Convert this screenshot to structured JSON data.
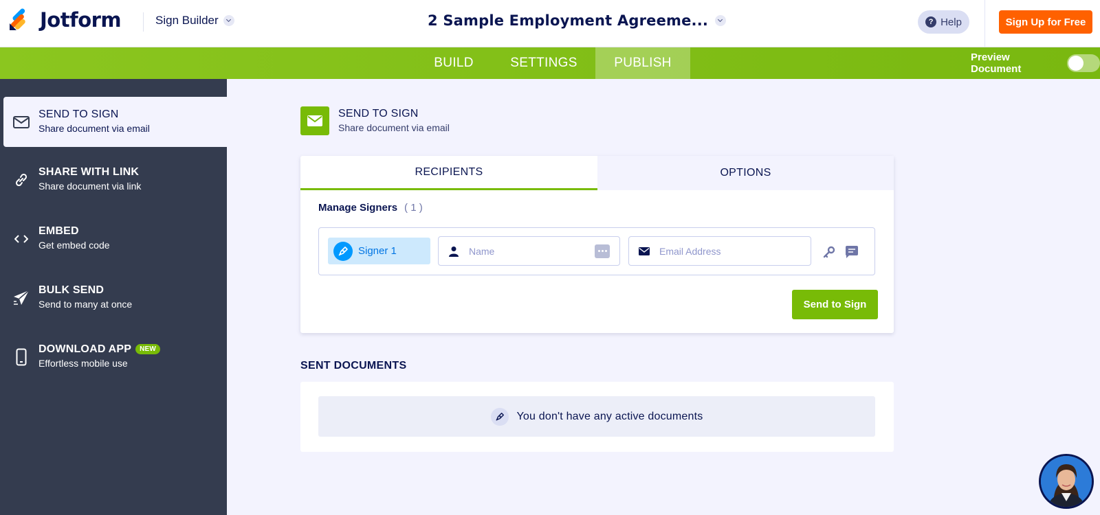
{
  "header": {
    "logo_text": "Jotform",
    "builder_label": "Sign Builder",
    "doc_title": "2 Sample Employment Agreeme...",
    "help_label": "Help",
    "signup_label": "Sign Up for Free"
  },
  "nav": {
    "tabs": [
      {
        "label": "BUILD"
      },
      {
        "label": "SETTINGS"
      },
      {
        "label": "PUBLISH",
        "active": true
      }
    ],
    "preview_label": "Preview Document",
    "preview_enabled": false
  },
  "sidebar": {
    "items": [
      {
        "title": "SEND TO SIGN",
        "subtitle": "Share document via email",
        "icon": "envelope-icon",
        "active": true
      },
      {
        "title": "SHARE WITH LINK",
        "subtitle": "Share document via link",
        "icon": "link-icon"
      },
      {
        "title": "EMBED",
        "subtitle": "Get embed code",
        "icon": "code-icon"
      },
      {
        "title": "BULK SEND",
        "subtitle": "Send to many at once",
        "icon": "paper-plane-icon"
      },
      {
        "title": "DOWNLOAD APP",
        "subtitle": "Effortless mobile use",
        "icon": "phone-icon",
        "badge": "NEW"
      }
    ]
  },
  "main": {
    "section_title": "SEND TO SIGN",
    "section_subtitle": "Share document via email",
    "tabs": [
      {
        "label": "RECIPIENTS",
        "active": true
      },
      {
        "label": "OPTIONS"
      }
    ],
    "manage_label": "Manage Signers",
    "manage_count": "( 1 )",
    "signer": {
      "label": "Signer 1",
      "name_placeholder": "Name",
      "email_placeholder": "Email Address"
    },
    "send_button": "Send to Sign",
    "sent_title": "SENT DOCUMENTS",
    "empty_message": "You don't have any active documents"
  },
  "colors": {
    "accent_green": "#78bb07",
    "signup_orange": "#ff6100",
    "sidebar_bg": "#343c4f",
    "signer_blue": "#0099ff"
  }
}
